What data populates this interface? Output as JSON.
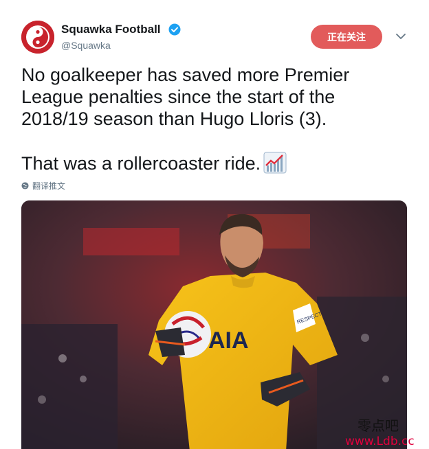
{
  "account": {
    "name": "Squawka Football",
    "handle": "@Squawka",
    "verified": true,
    "brand_color": "#c8232c"
  },
  "follow_button": {
    "label": "正在关注",
    "color": "#e25b5b"
  },
  "menu": {
    "icon": "chevron-down-icon"
  },
  "tweet": {
    "text": "No goalkeeper has saved more Premier\nLeague penalties since the start of the\n2018/19 season than Hugo Lloris (3).\n\nThat was a rollercoaster ride.",
    "emoji": "chart-increasing-emoji"
  },
  "translate": {
    "label": "翻译推文",
    "icon": "globe-icon"
  },
  "media": {
    "description_icon": "photo",
    "shirt_text": "AIA",
    "armband_text": "RESPECT"
  },
  "watermark": {
    "line1": "零点吧",
    "line2": "www.Ldb.cc"
  }
}
